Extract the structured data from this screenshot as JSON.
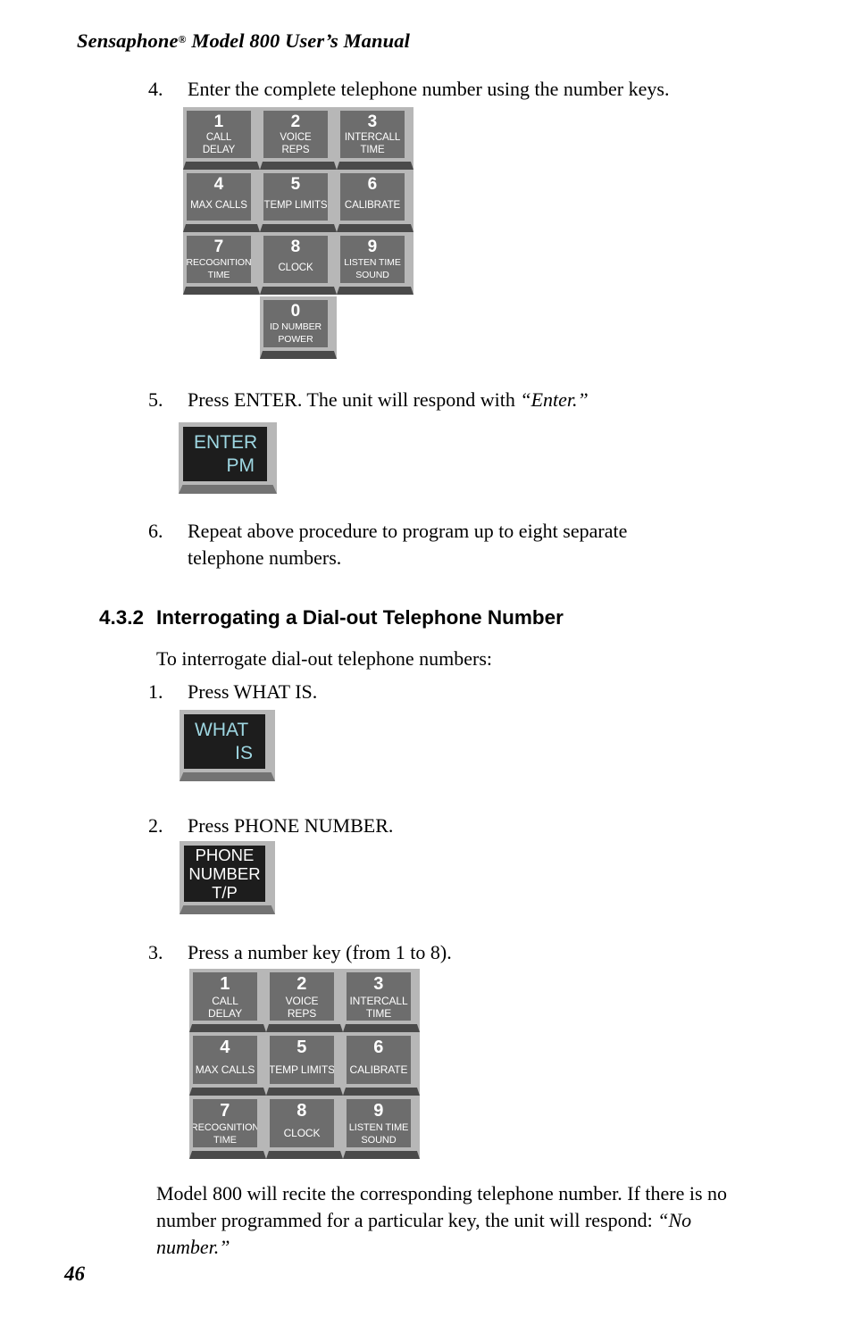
{
  "header": {
    "brand": "Sensaphone",
    "registered_mark": "®",
    "title_rest": " Model 800 User’s Manual"
  },
  "page_number": "46",
  "steps": {
    "step4": {
      "number": "4.",
      "text": "Enter the complete telephone number using the number keys."
    },
    "step5": {
      "number": "5.",
      "text_before": "Press ENTER. The unit will respond with ",
      "quote": "“Enter.”"
    },
    "step6": {
      "number": "6.",
      "text": "Repeat above procedure to program up to eight separate telephone numbers."
    },
    "s1": {
      "number": "1.",
      "text": "Press WHAT IS."
    },
    "s2": {
      "number": "2.",
      "text": "Press PHONE NUMBER."
    },
    "s3": {
      "number": "3.",
      "text": "Press a number key (from 1 to 8)."
    }
  },
  "section": {
    "number": "4.3.2",
    "title": "Interrogating a Dial-out Telephone Number",
    "intro": "To interrogate dial-out telephone numbers:"
  },
  "closing_paragraph": {
    "text_before": "Model 800 will recite the corresponding telephone number. If there is no number programmed for a particular key, the unit will respond: ",
    "quote": "“No number.”"
  },
  "keypad_1": {
    "keys": [
      {
        "digit": "1",
        "labels": [
          "CALL",
          "DELAY"
        ]
      },
      {
        "digit": "2",
        "labels": [
          "VOICE",
          "REPS"
        ]
      },
      {
        "digit": "3",
        "labels": [
          "INTERCALL",
          "TIME"
        ]
      },
      {
        "digit": "4",
        "labels": [
          "MAX CALLS"
        ]
      },
      {
        "digit": "5",
        "labels": [
          "TEMP LIMITS"
        ]
      },
      {
        "digit": "6",
        "labels": [
          "CALIBRATE"
        ]
      },
      {
        "digit": "7",
        "labels": [
          "RECOGNITION",
          "TIME"
        ]
      },
      {
        "digit": "8",
        "labels": [
          "CLOCK"
        ]
      },
      {
        "digit": "9",
        "labels": [
          "LISTEN TIME",
          "SOUND"
        ]
      }
    ],
    "zero_key": {
      "digit": "0",
      "labels": [
        "ID NUMBER",
        "POWER"
      ]
    }
  },
  "keypad_2": {
    "keys": [
      {
        "digit": "1",
        "labels": [
          "CALL",
          "DELAY"
        ]
      },
      {
        "digit": "2",
        "labels": [
          "VOICE",
          "REPS"
        ]
      },
      {
        "digit": "3",
        "labels": [
          "INTERCALL",
          "TIME"
        ]
      },
      {
        "digit": "4",
        "labels": [
          "MAX CALLS"
        ]
      },
      {
        "digit": "5",
        "labels": [
          "TEMP LIMITS"
        ]
      },
      {
        "digit": "6",
        "labels": [
          "CALIBRATE"
        ]
      },
      {
        "digit": "7",
        "labels": [
          "RECOGNITION",
          "TIME"
        ]
      },
      {
        "digit": "8",
        "labels": [
          "CLOCK"
        ]
      },
      {
        "digit": "9",
        "labels": [
          "LISTEN TIME",
          "SOUND"
        ]
      }
    ]
  },
  "function_keys": {
    "enter": {
      "line1": "ENTER",
      "line2": "PM"
    },
    "what_is": {
      "line1": "WHAT",
      "line2": "IS"
    },
    "phone_number": {
      "line1": "PHONE",
      "line2": "NUMBER",
      "line3": "T/P"
    }
  },
  "colors": {
    "key_face": "#6d6d6d",
    "key_frame": "#b7b7b7",
    "key_lip": "#4a4a4a",
    "fnkey_face": "#1d1d1d",
    "fnkey_text_cyan": "#9ed7e2",
    "text": "#000000",
    "page_background": "#ffffff"
  }
}
